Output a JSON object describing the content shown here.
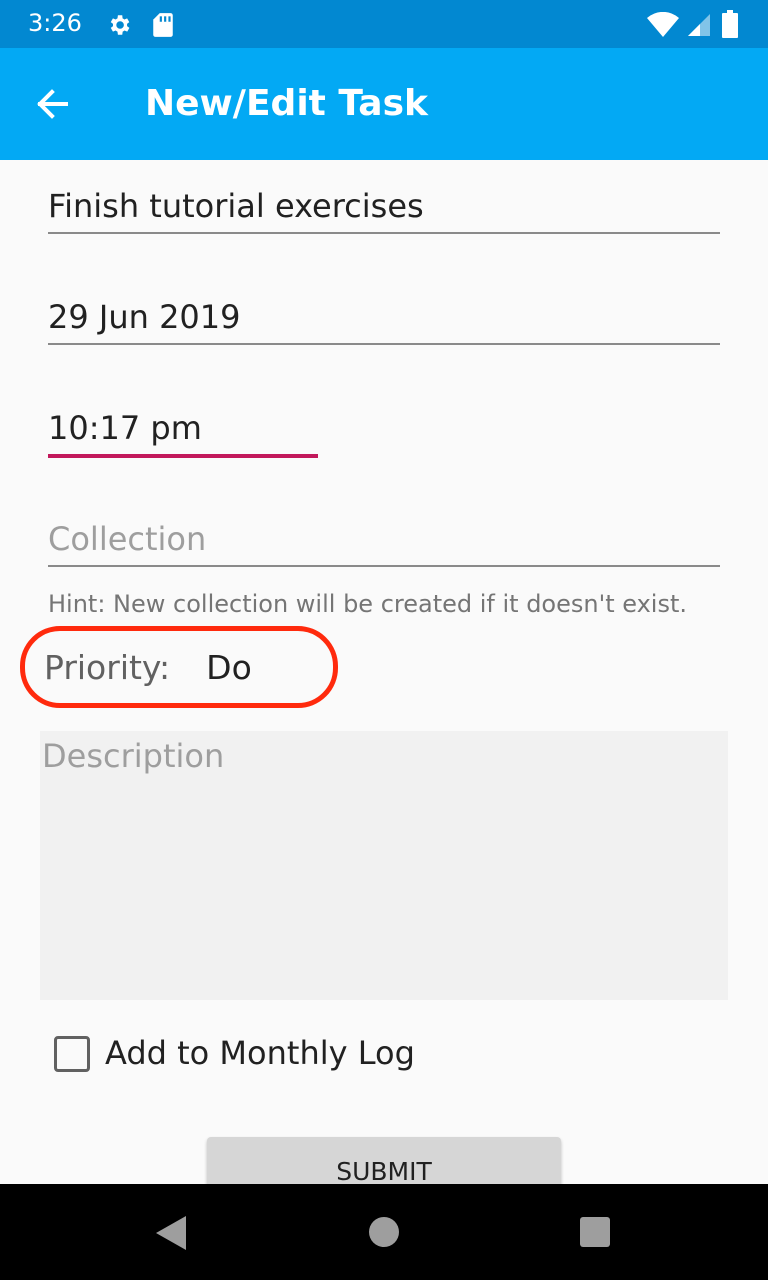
{
  "status_bar": {
    "time": "3:26"
  },
  "app_bar": {
    "title": "New/Edit Task"
  },
  "form": {
    "title_value": "Finish tutorial exercises",
    "date_value": "29 Jun 2019",
    "time_value": "10:17 pm",
    "collection_placeholder": "Collection",
    "collection_hint": "Hint: New collection will be created if it doesn't exist.",
    "priority_label": "Priority:",
    "priority_value": "Do",
    "description_placeholder": "Description",
    "monthly_log_label": "Add to Monthly Log",
    "monthly_log_checked": false,
    "submit_label": "SUBMIT"
  },
  "colors": {
    "status_bar": "#0288d1",
    "app_bar": "#03a9f4",
    "focus_underline": "#c2185b",
    "highlight": "#ff2a0d"
  }
}
